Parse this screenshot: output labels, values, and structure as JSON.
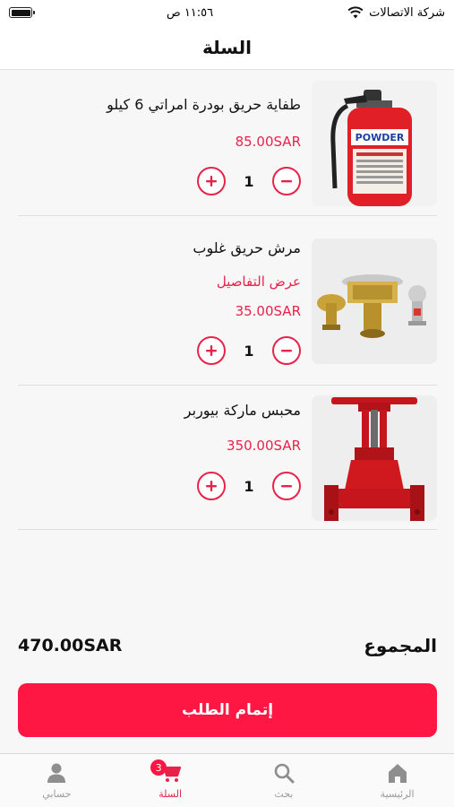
{
  "status_bar": {
    "carrier": "شركة الاتصالات",
    "time": "١١:٥٦ ص"
  },
  "header": {
    "title": "السلة"
  },
  "cart": {
    "items": [
      {
        "name": "طفاية حريق بودرة امراتي 6 كيلو",
        "details_link": "",
        "price": "85.00SAR",
        "quantity": "1",
        "image_icon": "fire-extinguisher"
      },
      {
        "name": "مرش حريق غلوب",
        "details_link": "عرض التفاصيل",
        "price": "35.00SAR",
        "quantity": "1",
        "image_icon": "fire-sprinklers"
      },
      {
        "name": "محبس ماركة بيوربر",
        "details_link": "",
        "price": "350.00SAR",
        "quantity": "1",
        "image_icon": "gate-valve"
      }
    ],
    "extinguisher_label": "POWDER"
  },
  "summary": {
    "total_label": "المجموع",
    "total_amount": "470.00SAR",
    "checkout_label": "إتمام الطلب"
  },
  "tab_bar": {
    "tabs": [
      {
        "label": "الرئيسية",
        "icon": "home-icon"
      },
      {
        "label": "بحث",
        "icon": "search-icon"
      },
      {
        "label": "السلة",
        "icon": "cart-icon",
        "badge": "3",
        "active": true
      },
      {
        "label": "حسابي",
        "icon": "user-icon"
      }
    ]
  },
  "colors": {
    "accent": "#e8234a",
    "button": "#ff1744"
  }
}
